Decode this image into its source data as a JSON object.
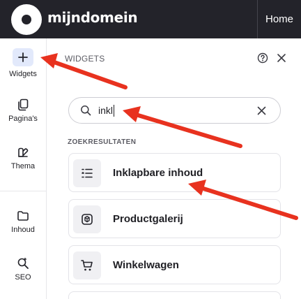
{
  "topbar": {
    "brand": "mijndomein",
    "home_label": "Home"
  },
  "rail": {
    "items": [
      {
        "label": "Widgets",
        "icon": "plus-icon"
      },
      {
        "label": "Pagina's",
        "icon": "pages-icon"
      },
      {
        "label": "Thema",
        "icon": "theme-icon"
      },
      {
        "label": "Inhoud",
        "icon": "folder-icon"
      },
      {
        "label": "SEO",
        "icon": "seo-search-icon"
      }
    ]
  },
  "panel": {
    "title": "WIDGETS"
  },
  "search": {
    "value": "inkl"
  },
  "results": {
    "label": "ZOEKRESULTATEN",
    "items": [
      {
        "label": "Inklapbare inhoud",
        "icon": "collapsible-list-icon"
      },
      {
        "label": "Productgalerij",
        "icon": "product-gallery-icon"
      },
      {
        "label": "Winkelwagen",
        "icon": "shopping-cart-icon"
      }
    ]
  },
  "annotation_color": "#e8321f"
}
